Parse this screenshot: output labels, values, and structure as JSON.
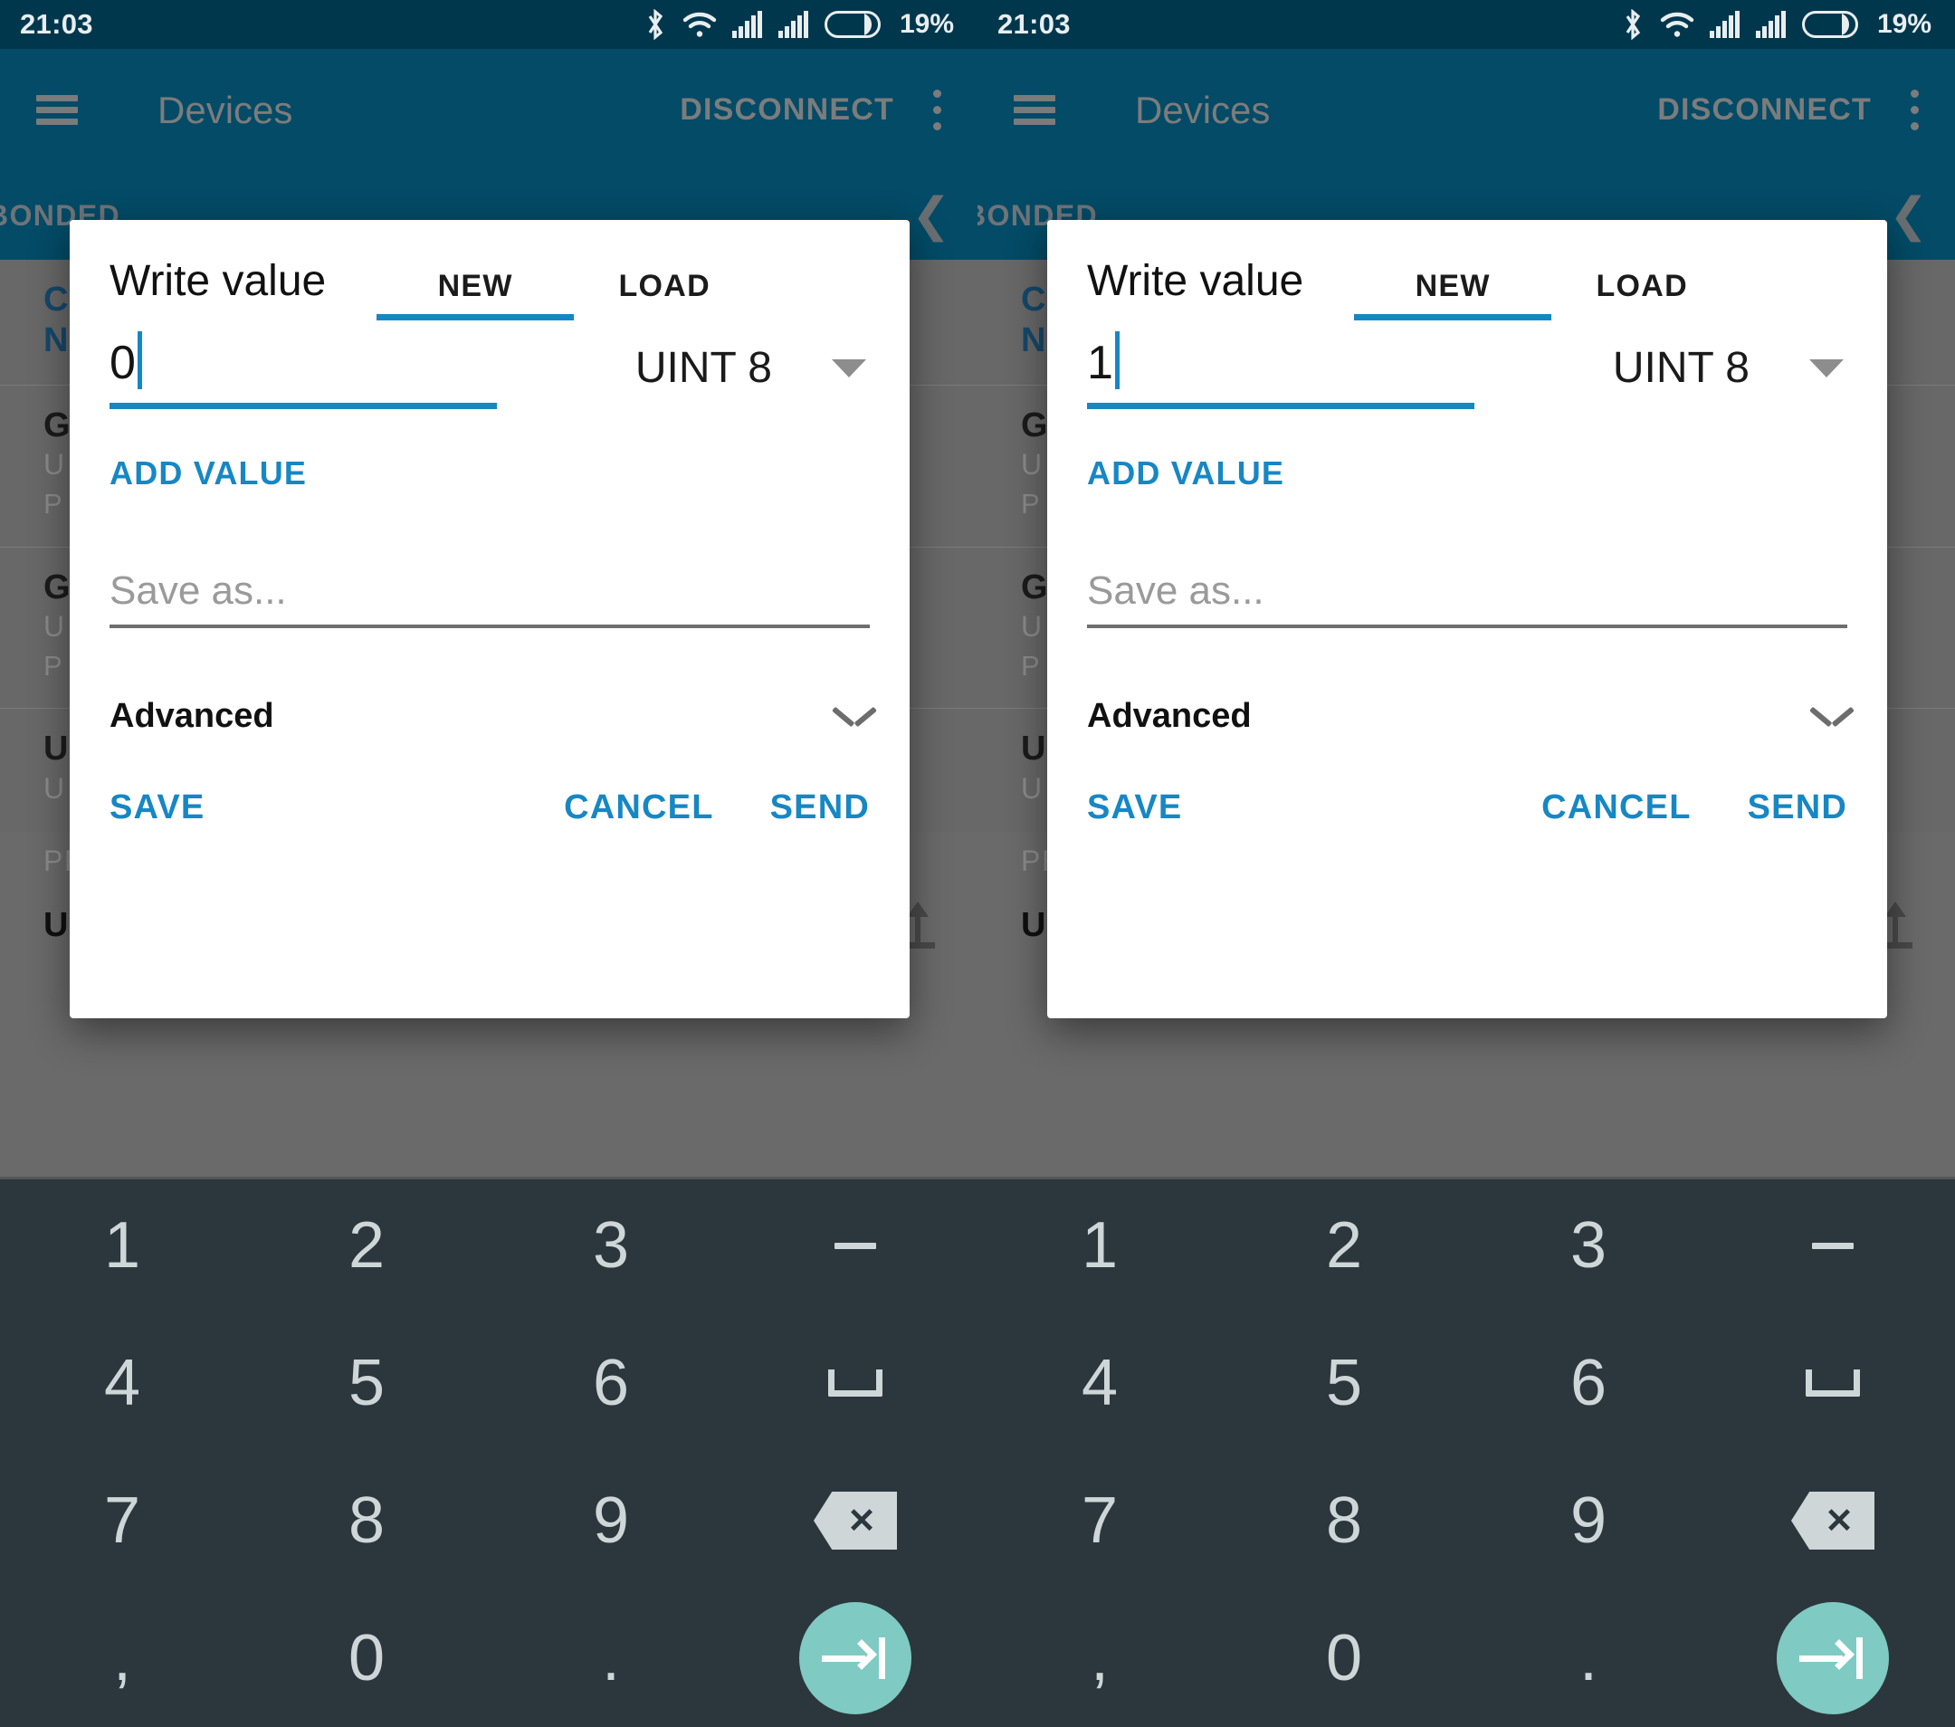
{
  "status_bar": {
    "time": "21:03",
    "battery_percent": "19%",
    "icons": [
      "bluetooth-icon",
      "wifi-icon",
      "signal-sim1-icon",
      "signal-sim2-icon",
      "battery-icon"
    ]
  },
  "app_bar": {
    "menu_icon": "hamburger-menu-icon",
    "title": "Devices",
    "action_label": "DISCONNECT",
    "overflow_icon": "overflow-menu-icon"
  },
  "tab_strip": {
    "label": "BONDED",
    "chevron": "❮"
  },
  "background_list": {
    "cards": [
      {
        "title": "C",
        "sub": "N",
        "sub2": ""
      },
      {
        "title": "G",
        "sub": "U",
        "sub2": "P"
      },
      {
        "title": "G",
        "sub": "U",
        "sub2": "P"
      },
      {
        "title": "U",
        "sub": "U",
        "sub2": ""
      }
    ],
    "section_label": "PRIMARY SERVICE",
    "characteristic": {
      "name": "Unknown Characteristic",
      "uuid": "",
      "read_icon": "download-arrow-icon",
      "write_icon": "upload-arrow-icon"
    }
  },
  "dialogs": [
    {
      "title": "Write value",
      "tabs": [
        {
          "label": "NEW",
          "active": true
        },
        {
          "label": "LOAD",
          "active": false
        }
      ],
      "value": "0",
      "value_type": "UINT 8",
      "add_value_label": "ADD VALUE",
      "save_as_placeholder": "Save as...",
      "save_as_value": "",
      "advanced_label": "Advanced",
      "advanced_expanded": false,
      "actions": {
        "save": "SAVE",
        "cancel": "CANCEL",
        "send": "SEND"
      }
    },
    {
      "title": "Write value",
      "tabs": [
        {
          "label": "NEW",
          "active": true
        },
        {
          "label": "LOAD",
          "active": false
        }
      ],
      "value": "1",
      "value_type": "UINT 8",
      "add_value_label": "ADD VALUE",
      "save_as_placeholder": "Save as...",
      "save_as_value": "",
      "advanced_label": "Advanced",
      "advanced_expanded": false,
      "actions": {
        "save": "SAVE",
        "cancel": "CANCEL",
        "send": "SEND"
      }
    }
  ],
  "keyboard": {
    "type": "numeric-keypad",
    "rows": [
      [
        "1",
        "2",
        "3",
        "minus"
      ],
      [
        "4",
        "5",
        "6",
        "space"
      ],
      [
        "7",
        "8",
        "9",
        "backspace"
      ],
      [
        ",",
        "0",
        ".",
        "tab-next"
      ]
    ],
    "keys": {
      "k1": "1",
      "k2": "2",
      "k3": "3",
      "k4": "4",
      "k5": "5",
      "k6": "6",
      "k7": "7",
      "k8": "8",
      "k9": "9",
      "kcomma": ",",
      "k0": "0",
      "kdot": "."
    },
    "accent_color": "#7fcac3"
  },
  "colors": {
    "status_bar": "#00374d",
    "app_bar": "#034b67",
    "accent_blue": "#1787c4",
    "dim_overlay": "#6a6a6a",
    "keyboard_bg": "#2b373d",
    "key_text": "#cfd6d8"
  }
}
